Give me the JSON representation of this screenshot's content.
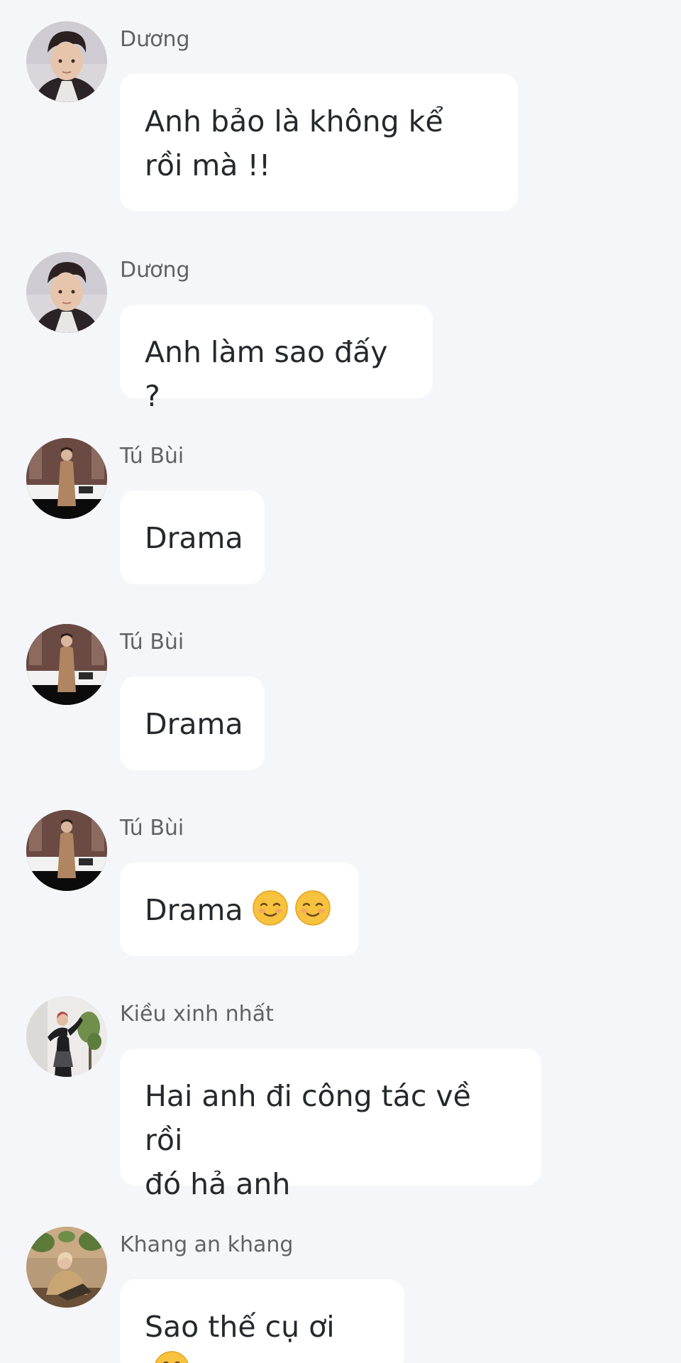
{
  "messages": [
    {
      "sender": "Dương",
      "text_lines": [
        "Anh bảo là không kể",
        "rồi mà !!"
      ],
      "avatar": "duong-avatar"
    },
    {
      "sender": "Dương",
      "text_lines": [
        "Anh làm sao đấy ?"
      ],
      "avatar": "duong-avatar"
    },
    {
      "sender": "Tú Bùi",
      "text_lines": [
        "Drama"
      ],
      "avatar": "tu-bui-avatar"
    },
    {
      "sender": "Tú Bùi",
      "text_lines": [
        "Drama"
      ],
      "avatar": "tu-bui-avatar"
    },
    {
      "sender": "Tú Bùi",
      "text_lines": [
        "Drama"
      ],
      "emojis": [
        "smiling-face-emoji",
        "smiling-face-emoji"
      ],
      "avatar": "tu-bui-avatar"
    },
    {
      "sender": "Kiều xinh nhất",
      "text_lines": [
        "Hai anh đi công tác về rồi",
        "đó hả anh"
      ],
      "avatar": "kieu-avatar"
    },
    {
      "sender": "Khang an khang",
      "text_lines": [
        "Sao thế cụ ơi"
      ],
      "emojis": [
        "grinning-face-emoji"
      ],
      "avatar": "khang-avatar"
    }
  ],
  "colors": {
    "background": "#f5f6f9",
    "bubble": "#ffffff",
    "sender_text": "#5f6368",
    "message_text": "#25282c"
  }
}
